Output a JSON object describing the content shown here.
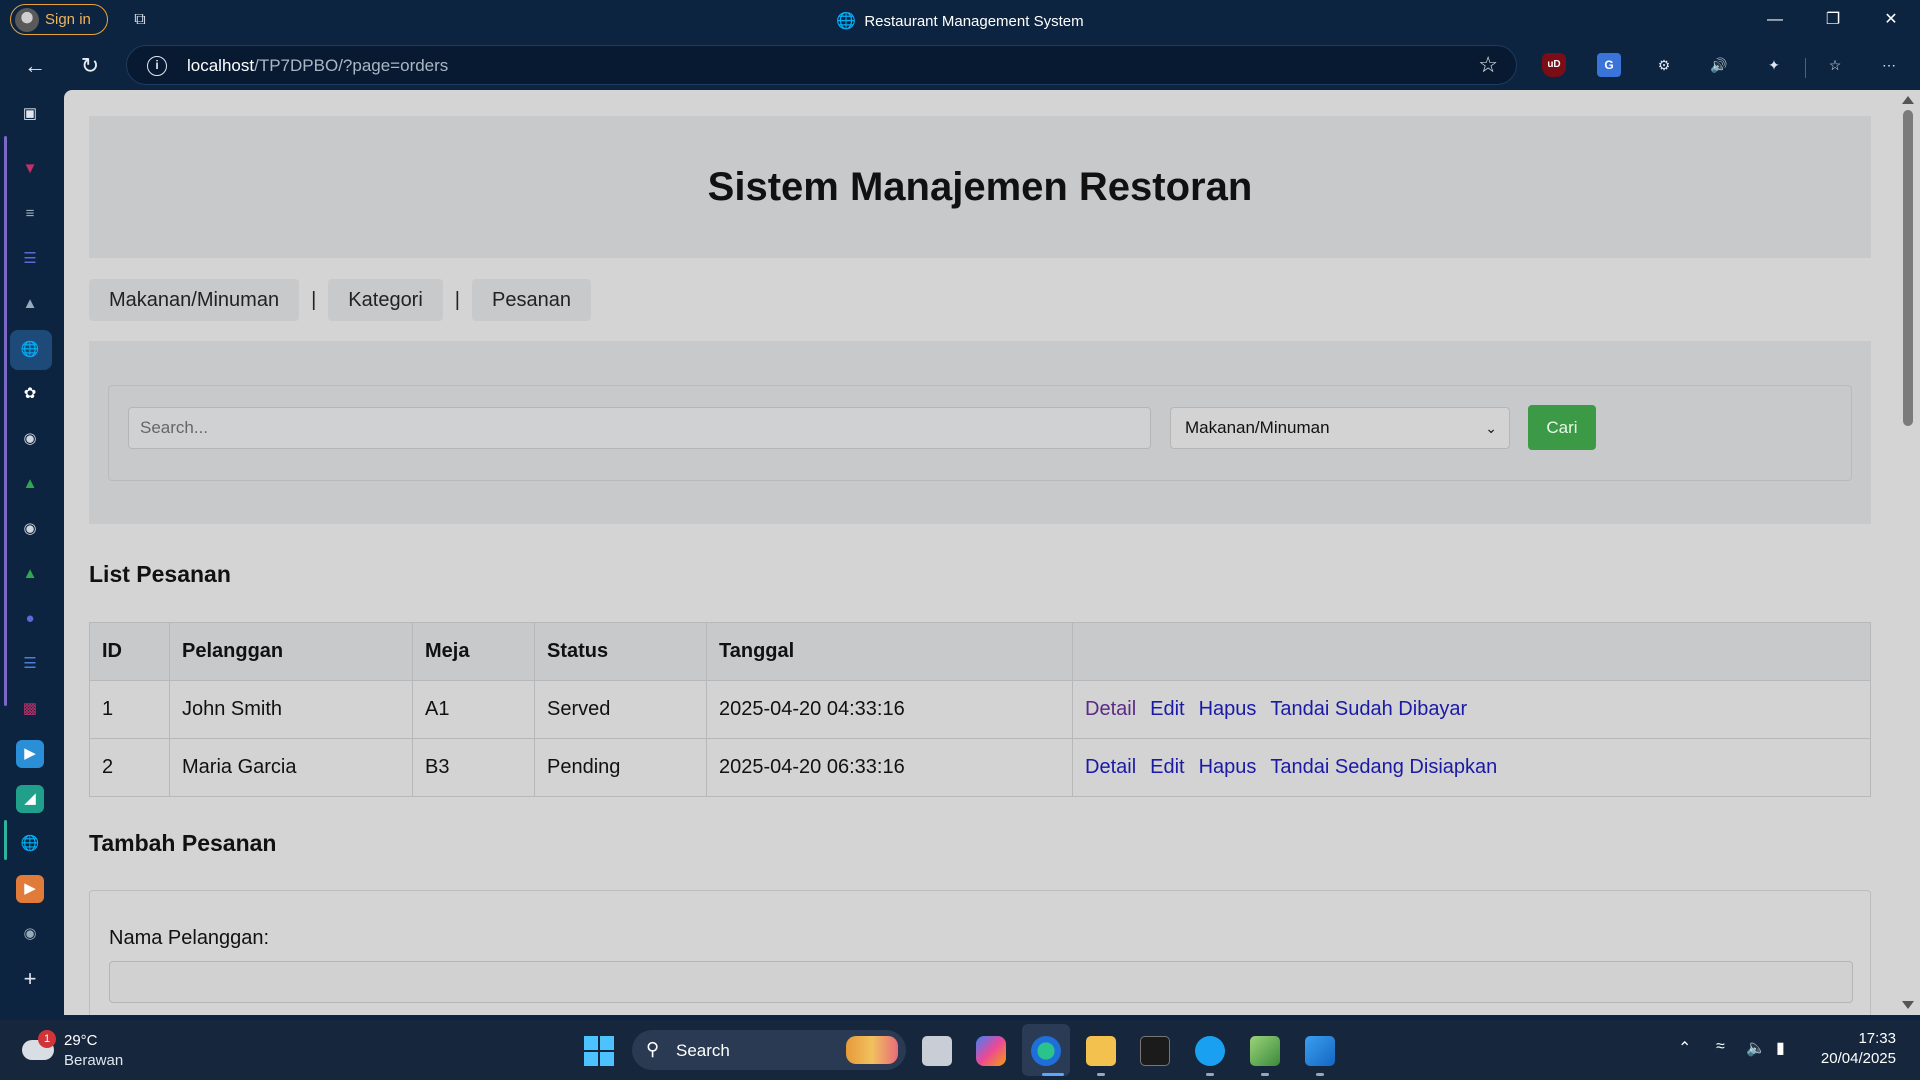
{
  "browser": {
    "sign_in_label": "Sign in",
    "window_title": "Restaurant Management System",
    "url_host": "localhost",
    "url_path": "/TP7DPBO/?page=orders",
    "ext_ublock": "uD",
    "ext_translate": "G"
  },
  "page": {
    "title": "Sistem Manajemen Restoran",
    "nav": [
      "Makanan/Minuman",
      "Kategori",
      "Pesanan"
    ],
    "nav_separator": "|",
    "search": {
      "placeholder": "Search...",
      "selected": "Makanan/Minuman",
      "button": "Cari"
    },
    "list_heading": "List Pesanan",
    "table": {
      "headers": [
        "ID",
        "Pelanggan",
        "Meja",
        "Status",
        "Tanggal",
        ""
      ],
      "rows": [
        {
          "id": "1",
          "customer": "John Smith",
          "table": "A1",
          "status": "Served",
          "date": "2025-04-20 04:33:16",
          "actions": [
            "Detail",
            "Edit",
            "Hapus",
            "Tandai Sudah Dibayar"
          ]
        },
        {
          "id": "2",
          "customer": "Maria Garcia",
          "table": "B3",
          "status": "Pending",
          "date": "2025-04-20 06:33:16",
          "actions": [
            "Detail",
            "Edit",
            "Hapus",
            "Tandai Sedang Disiapkan"
          ]
        }
      ]
    },
    "add_heading": "Tambah Pesanan",
    "form": {
      "customer_label": "Nama Pelanggan:"
    }
  },
  "taskbar": {
    "weather_temp": "29°C",
    "weather_desc": "Berawan",
    "weather_badge": "1",
    "search_label": "Search",
    "time": "17:33",
    "date": "20/04/2025"
  },
  "colors": {
    "status_served": "#3f8f3f",
    "status_pending": "#cc8a2a",
    "button_green": "#3c9a46",
    "link": "#1a1aa6",
    "link_visited": "#5a2a86"
  }
}
